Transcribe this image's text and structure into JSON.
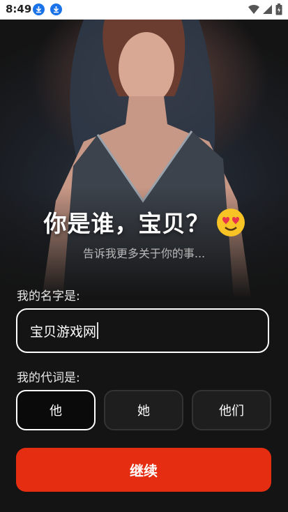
{
  "status_bar": {
    "time": "8:49"
  },
  "hero": {
    "title": "你是谁，宝贝？",
    "subtitle": "告诉我更多关于你的事..."
  },
  "form": {
    "name_label": "我的名字是:",
    "name_value": "宝贝游戏网",
    "pronoun_label": "我的代词是:",
    "pronouns": [
      "他",
      "她",
      "他们"
    ],
    "selected_pronoun": "他"
  },
  "continue_label": "继续",
  "colors": {
    "accent": "#e52d12",
    "background": "#141414"
  },
  "icons": [
    "download-icon",
    "wifi-icon",
    "signal-icon",
    "battery-icon",
    "heart-eyes-emoji"
  ]
}
